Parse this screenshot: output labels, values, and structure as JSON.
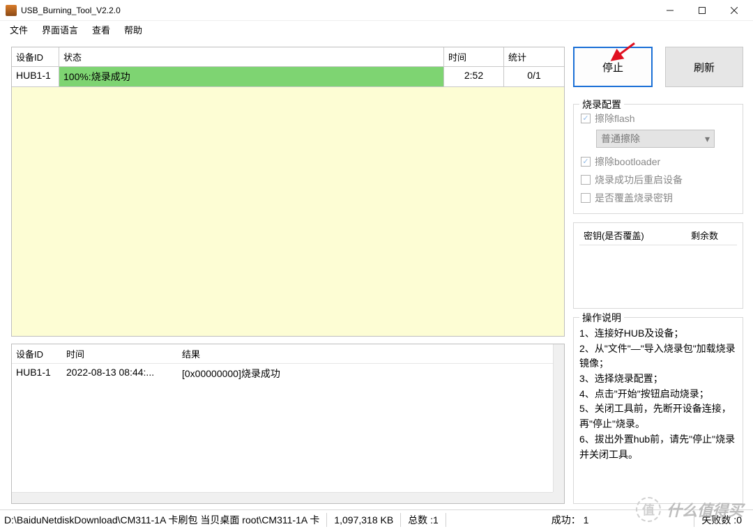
{
  "window": {
    "title": "USB_Burning_Tool_V2.2.0"
  },
  "menu": {
    "file": "文件",
    "lang": "界面语言",
    "view": "查看",
    "help": "帮助"
  },
  "table": {
    "head": {
      "id": "设备ID",
      "status": "状态",
      "time": "时间",
      "stat": "统计"
    },
    "row": {
      "id": "HUB1-1",
      "status": "100%:烧录成功",
      "time": "2:52",
      "stat": "0/1"
    }
  },
  "log": {
    "head": {
      "id": "设备ID",
      "time": "时间",
      "result": "结果"
    },
    "row": {
      "id": "HUB1-1",
      "time": "2022-08-13 08:44:...",
      "result": "[0x00000000]烧录成功"
    }
  },
  "buttons": {
    "stop": "停止",
    "refresh": "刷新"
  },
  "config": {
    "title": "烧录配置",
    "eraseFlash": "擦除flash",
    "eraseMode": "普通擦除",
    "eraseBootloader": "擦除bootloader",
    "rebootAfter": "烧录成功后重启设备",
    "overwriteKey": "是否覆盖烧录密钥"
  },
  "keys": {
    "col1": "密钥(是否覆盖)",
    "col2": "剩余数"
  },
  "help": {
    "title": "操作说明",
    "text": "1、连接好HUB及设备；\n2、从\"文件\"—\"导入烧录包\"加载烧录镜像；\n3、选择烧录配置；\n4、点击\"开始\"按钮启动烧录；\n5、关闭工具前，先断开设备连接，再\"停止\"烧录。\n6、拔出外置hub前，请先\"停止\"烧录并关闭工具。"
  },
  "status": {
    "path": "D:\\BaiduNetdiskDownload\\CM311-1A 卡刷包 当贝桌面 root\\CM311-1A 卡",
    "size": "1,097,318 KB",
    "totalLabel": "总数 :",
    "totalVal": "1",
    "okLabel": "成功：",
    "okVal": "1",
    "failLabel": "失败数 :",
    "failVal": "0"
  },
  "watermark": {
    "icon": "值",
    "text": "什么值得买"
  }
}
